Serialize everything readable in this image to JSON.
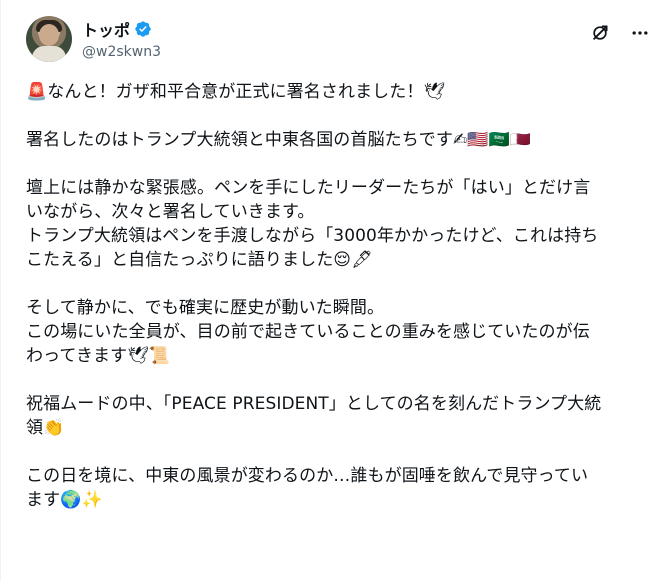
{
  "author": {
    "display_name": "トッポ",
    "handle": "@w2skwn3"
  },
  "icons": {
    "verified": "verified-badge-icon",
    "grok": "grok-icon",
    "more": "more-icon"
  },
  "colors": {
    "verified": "#1d9bf0",
    "text": "#0f1419",
    "secondary": "#536471"
  },
  "tweet": {
    "p1": {
      "l1": "🚨なんと！ガザ和平合意が正式に署名されました！🕊"
    },
    "p2": {
      "l1": "署名したのはトランプ大統領と中東各国の首脳たちです✍🇺🇸🇸🇦🇶🇦"
    },
    "p3": {
      "l1": "壇上には静かな緊張感。ペンを手にしたリーダーたちが「はい」とだけ言",
      "l2": "いながら、次々と署名していきます。",
      "l3": "トランプ大統領はペンを手渡しながら「3000年かかったけど、これは持ち",
      "l4": "こたえる」と自信たっぷりに語りました😌🖋"
    },
    "p4": {
      "l1": "そして静かに、でも確実に歴史が動いた瞬間。",
      "l2": "この場にいた全員が、目の前で起きていることの重みを感じていたのが伝",
      "l3": "わってきます🕊📜"
    },
    "p5": {
      "l1": "祝福ムードの中、「PEACE PRESIDENT」としての名を刻んだトランプ大統",
      "l2": "領👏"
    },
    "p6": {
      "l1": "この日を境に、中東の風景が変わるのか…誰もが固唾を飲んで見守ってい",
      "l2": "ます🌍✨"
    }
  }
}
